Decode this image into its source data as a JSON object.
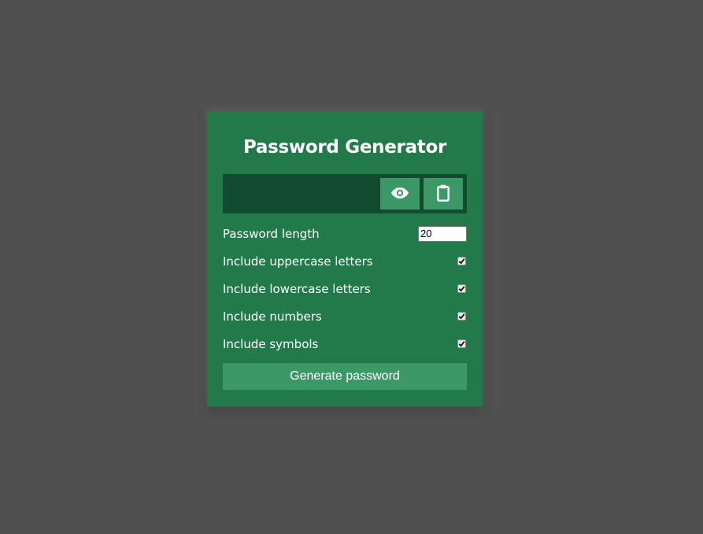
{
  "app": {
    "title": "Password Generator"
  },
  "result": {
    "value": "",
    "show_icon": "eye-icon",
    "copy_icon": "clipboard-icon"
  },
  "settings": {
    "length_label": "Password length",
    "length_value": "20",
    "options": [
      {
        "label": "Include uppercase letters",
        "checked": true
      },
      {
        "label": "Include lowercase letters",
        "checked": true
      },
      {
        "label": "Include numbers",
        "checked": true
      },
      {
        "label": "Include symbols",
        "checked": true
      }
    ]
  },
  "generate": {
    "label": "Generate password"
  },
  "colors": {
    "page_background": "#505050",
    "card_background": "#227a4b",
    "result_background": "#124b30",
    "button_background": "#3d9867",
    "text": "#ffffff"
  }
}
